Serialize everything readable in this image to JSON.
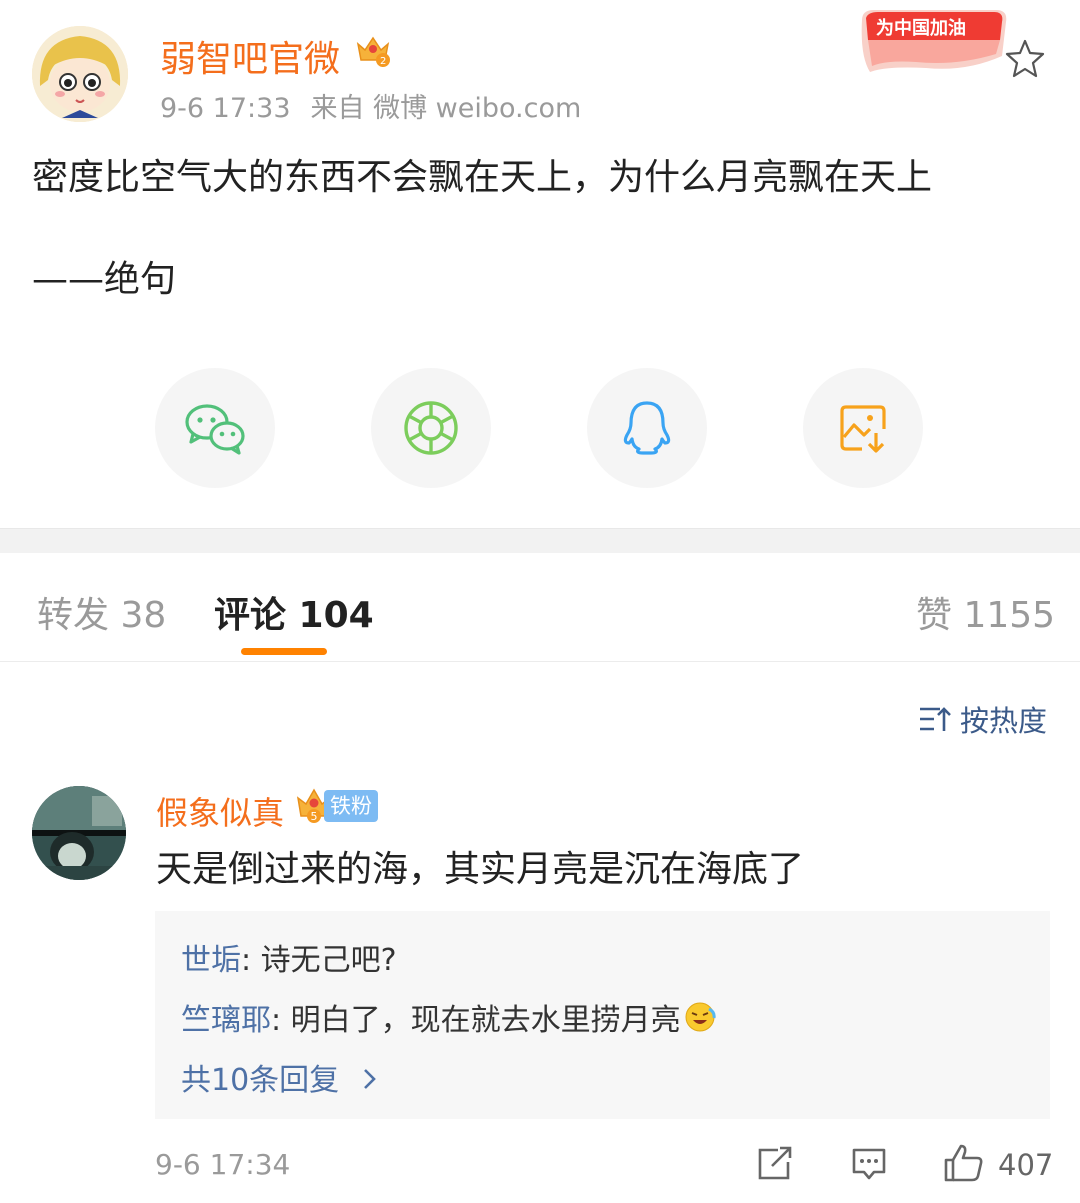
{
  "post": {
    "author": "弱智吧官微",
    "date": "9-6 17:33",
    "source": "来自 微博 weibo.com",
    "badge_text": "为中国加油",
    "text": "密度比空气大的东西不会飘在天上，为什么月亮飘在天上",
    "signature": "——绝句"
  },
  "share_icons": [
    "wechat-icon",
    "moments-icon",
    "qq-icon",
    "save-image-icon"
  ],
  "tabs": {
    "forward": "转发 38",
    "comments": "评论 104",
    "likes": "赞 1155"
  },
  "sort_label": "按热度",
  "comment": {
    "author": "假象似真",
    "vip_level": "5",
    "fan_badge": "铁粉",
    "text": "天是倒过来的海，其实月亮是沉在海底了",
    "replies": [
      {
        "name": "世垢",
        "text": ": 诗无己吧?"
      },
      {
        "name": "竺璃耶",
        "text": ": 明白了，现在就去水里捞月亮"
      }
    ],
    "more_replies": "共10条回复",
    "time": "9-6 17:34",
    "likes": "407"
  },
  "colors": {
    "author_orange": "#f46e1c",
    "accent": "#ff8200",
    "link_blue": "#4e71a6",
    "wechat_green": "#52c07a"
  }
}
